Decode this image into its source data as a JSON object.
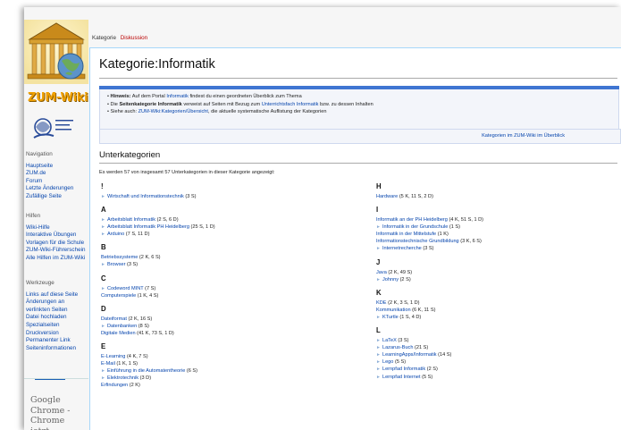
{
  "sidebar": {
    "logo_text": "ZUM-Wiki",
    "sections": [
      {
        "title": "Navigation",
        "items": [
          "Hauptseite",
          "ZUM.de",
          "Forum",
          "Letzte Änderungen",
          "Zufällige Seite"
        ]
      },
      {
        "title": "Hilfen",
        "items": [
          "Wiki-Hilfe",
          "Interaktive Übungen",
          "Vorlagen für die Schule",
          "ZUM-Wiki-Führerschein",
          "Alle Hilfen im ZUM-Wiki"
        ]
      },
      {
        "title": "Werkzeuge",
        "items": [
          "Links auf diese Seite",
          "Änderungen an verlinkten Seiten",
          "Datei hochladen",
          "Spezialseiten",
          "Druckversion",
          "Permanenter Link",
          "Seiteninformationen"
        ]
      }
    ],
    "ad_text": "Google Chrome - Chrome jetzt herunterladen"
  },
  "tabs": {
    "active": "Kategorie",
    "other": "Diskussion"
  },
  "page_title": "Kategorie:Informatik",
  "hints": {
    "h1_bold": "Hinweis:",
    "h1_a": "Auf dem Portal",
    "h1_link": "Informatik",
    "h1_b": "findest du einen geordneten Überblick zum Thema",
    "h2_a": "Die",
    "h2_bold": "Seitenkategorie Informatik",
    "h2_b": "verweist auf Seiten mit Bezug zum",
    "h2_link": "Unterrichtsfach Informatik",
    "h2_c": "bzw. zu dessen Inhalten",
    "h3_a": "Siehe auch:",
    "h3_link": "ZUM-Wiki:Kategorien/Übersicht",
    "h3_b": ", die aktuelle systematische Auflistung der Kategorien"
  },
  "overview_link": "Kategorien im ZUM-Wiki im Überblick",
  "subcat_title": "Unterkategorien",
  "subcat_count": "Es werden 57 von insgesamt 57 Unterkategorien in dieser Kategorie angezeigt:",
  "left_groups": [
    {
      "letter": "!",
      "items": [
        {
          "name": "Wirtschaft und Informationstechnik",
          "count": "(3 S)",
          "child": true
        }
      ]
    },
    {
      "letter": "A",
      "items": [
        {
          "name": "Arbeitsblatt Informatik",
          "count": "(2 S, 6 D)",
          "child": true
        },
        {
          "name": "Arbeitsblatt Informatik PH Heidelberg",
          "count": "(25 S, 1 D)",
          "child": true
        },
        {
          "name": "Arduino",
          "count": "(7 S, 11 D)",
          "child": true
        }
      ]
    },
    {
      "letter": "B",
      "items": [
        {
          "name": "Betriebssysteme",
          "count": "(2 K, 6 S)",
          "child": false
        },
        {
          "name": "Browser",
          "count": "(3 S)",
          "child": true
        }
      ]
    },
    {
      "letter": "C",
      "items": [
        {
          "name": "Codeword MINT",
          "count": "(7 S)",
          "child": true
        },
        {
          "name": "Computerspiele",
          "count": "(1 K, 4 S)",
          "child": false
        }
      ]
    },
    {
      "letter": "D",
      "items": [
        {
          "name": "Dateiformat",
          "count": "(2 K, 16 S)",
          "child": false
        },
        {
          "name": "Datenbanken",
          "count": "(8 S)",
          "child": true
        },
        {
          "name": "Digitale Medien",
          "count": "(41 K, 73 S, 1 D)",
          "child": false
        }
      ]
    },
    {
      "letter": "E",
      "items": [
        {
          "name": "E-Learning",
          "count": "(4 K, 7 S)",
          "child": false
        },
        {
          "name": "E-Mail",
          "count": "(1 K, 1 S)",
          "child": false
        },
        {
          "name": "Einführung in die Automatentheorie",
          "count": "(6 S)",
          "child": true
        },
        {
          "name": "Elektrotechnik",
          "count": "(3 D)",
          "child": true
        },
        {
          "name": "Erfindungen",
          "count": "(2 K)",
          "child": false
        }
      ]
    }
  ],
  "right_groups": [
    {
      "letter": "H",
      "items": [
        {
          "name": "Hardware",
          "count": "(5 K, 11 S, 2 D)",
          "child": false
        }
      ]
    },
    {
      "letter": "I",
      "items": [
        {
          "name": "Informatik an der PH Heidelberg",
          "count": "(4 K, 51 S, 1 D)",
          "child": false
        },
        {
          "name": "Informatik in der Grundschule",
          "count": "(1 S)",
          "child": true
        },
        {
          "name": "Informatik in der Mittelstufe",
          "count": "(1 K)",
          "child": false
        },
        {
          "name": "Informationstechnische Grundbildung",
          "count": "(3 K, 6 S)",
          "child": false
        },
        {
          "name": "Internetrecherche",
          "count": "(3 S)",
          "child": true
        }
      ]
    },
    {
      "letter": "J",
      "items": [
        {
          "name": "Java",
          "count": "(2 K, 49 S)",
          "child": false
        },
        {
          "name": "Johnny",
          "count": "(2 S)",
          "child": true
        }
      ]
    },
    {
      "letter": "K",
      "items": [
        {
          "name": "KDE",
          "count": "(2 K, 3 S, 1 D)",
          "child": false
        },
        {
          "name": "Kommunikation",
          "count": "(6 K, 11 S)",
          "child": false
        },
        {
          "name": "KTurtle",
          "count": "(1 S, 4 D)",
          "child": true
        }
      ]
    },
    {
      "letter": "L",
      "items": [
        {
          "name": "LaTeX",
          "count": "(3 S)",
          "child": true
        },
        {
          "name": "Lazarus-Buch",
          "count": "(21 S)",
          "child": true
        },
        {
          "name": "LearningApps/Informatik",
          "count": "(14 S)",
          "child": true
        },
        {
          "name": "Lego",
          "count": "(5 S)",
          "child": true
        },
        {
          "name": "Lernpfad Informatik",
          "count": "(2 S)",
          "child": true
        },
        {
          "name": "Lernpfad Internet",
          "count": "(5 S)",
          "child": true
        }
      ]
    }
  ],
  "colors": {
    "link": "#0645ad",
    "logo": "#f0a000",
    "bar": "#3f75d2"
  },
  "icons": [
    "zum-wiki-logo-icon",
    "education-logo-icon",
    "expand-triangle-icon"
  ]
}
